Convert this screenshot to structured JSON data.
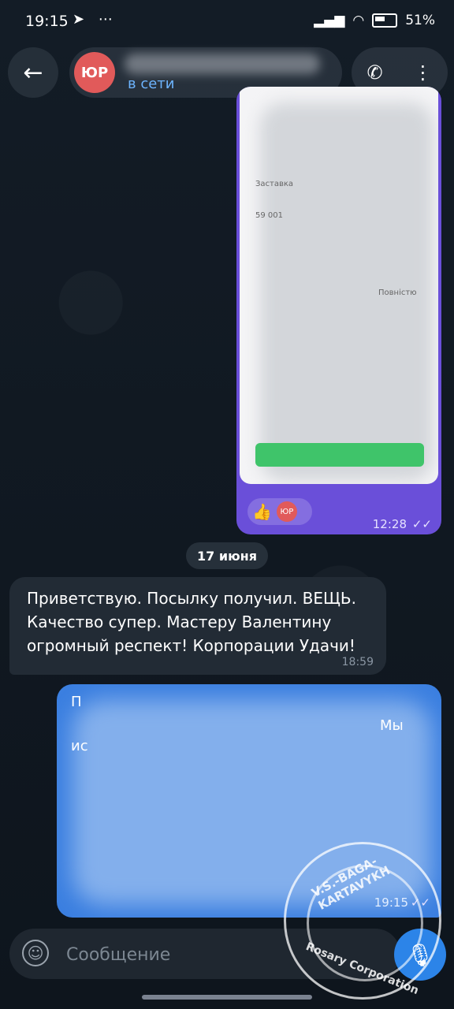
{
  "status_bar": {
    "time": "19:15",
    "battery": "51%"
  },
  "chat_header": {
    "avatar_initials": "ЮР",
    "status": "в сети"
  },
  "messages": {
    "photo": {
      "reaction_emoji": "👍",
      "reaction_initials": "ЮР",
      "time": "12:28",
      "screenshot_snippets": [
        "Заставка",
        "59 001",
        "Повністю"
      ]
    },
    "date_separator": "17 июня",
    "incoming": {
      "text": "Приветствую. Посылку получил. ВЕЩЬ. Качество супер. Мастеру Валентину огромный респект! Корпорации Удачи!",
      "time": "18:59"
    },
    "outgoing_blue": {
      "visible_fragments": [
        "П",
        "ис",
        "Мы"
      ],
      "time": "19:15"
    }
  },
  "composer": {
    "placeholder": "Сообщение"
  },
  "watermark": {
    "top_text": "V.S.-BAGA-KARTAVYKH",
    "bottom_text": "Rosary Corporation"
  }
}
